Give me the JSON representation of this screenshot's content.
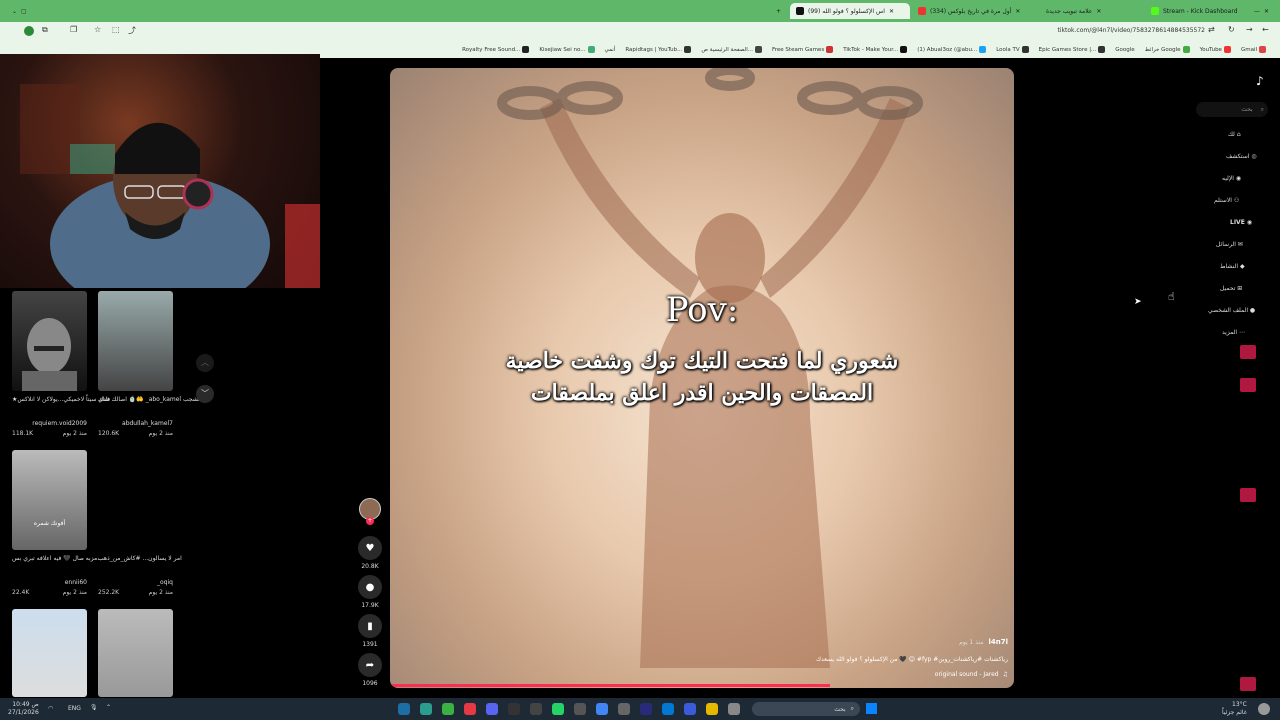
{
  "browser": {
    "tabs": [
      {
        "title": "(99) اس الإكسلولو ؟ فولو الله"
      },
      {
        "title": "(334) أول مرة في تاريخ بلوكس"
      },
      {
        "title": "علامة تبويب جديدة"
      },
      {
        "title": "Stream - Kick Dashboard"
      }
    ],
    "url": "tiktok.com/@l4n7l/video/7583278614884535572",
    "bookmarks": [
      "Royalty Free Sound...",
      "Kisejiaw Sei no...",
      "أنمي",
      "Rapidtags | YouTub...",
      "الصفحة الرئيسية ص...",
      "Free Steam Games",
      "TikTok - Make Your...",
      "(1) Abual3oz (@abu...",
      "Loola TV",
      "Epic Games Store |...",
      "Google",
      "خرائط Google",
      "YouTube",
      "Gmail"
    ]
  },
  "feed": {
    "cards": [
      {
        "caption": "★فلتك سيتاً\nلاخميكي...يولاكن لا انلاكس",
        "user": "requiem.void2009",
        "likes": "118.1K",
        "age": "منذ 2 يوم"
      },
      {
        "caption": "اصالك شاي 🍵🤲\n_abo_kamel المشجب",
        "user": "abdullah_kamel7",
        "likes": "120.6K",
        "age": "منذ 2 يوم"
      },
      {
        "caption": "مزبه صال 🖤 فيه اعلافه\nتبري بس...",
        "user": "ennii60",
        "likes": "22.4K",
        "age": "منذ 2 يوم"
      },
      {
        "caption": "امر لا يسالون...\n#كاش_من_ذهب",
        "user": "_oqiq",
        "likes": "252.2K",
        "age": "منذ 2 يوم"
      }
    ],
    "card_overlay_text": "أفونك شمره"
  },
  "video": {
    "title_line": "Pov:",
    "text_line1": "شعوري لما فتحت التيك توك وشفت خاصية",
    "text_line2": "المصقات والحين اقدر اعلق بملصقات",
    "author": "l4n7l",
    "posted": "منذ 1 يوم",
    "description": "من الإكسلولو ؟ فولو الله يسعدك 🖤 😊 #fyp #رياكشنات #رياكشنات_روبن",
    "sound": "original sound - Jared",
    "likes": "20.8K",
    "comments": "17.9K",
    "saves": "1391",
    "shares": "1096"
  },
  "nav": {
    "search_placeholder": "بحث",
    "items": [
      "لك",
      "استكشف",
      "الإليه",
      "الاستلم",
      "LIVE",
      "الرسائل",
      "النشاط",
      "تحميل",
      "الملف الشخصي",
      "المزيد"
    ]
  },
  "taskbar": {
    "weather": "13°C",
    "weather_desc": "غائم جزئياً",
    "search": "بحث",
    "lang": "ENG",
    "time": "10:49 ص",
    "date": "27/1/2026"
  },
  "colors": {
    "accent": "#fe2c55",
    "browser_green": "#5fb86a"
  }
}
